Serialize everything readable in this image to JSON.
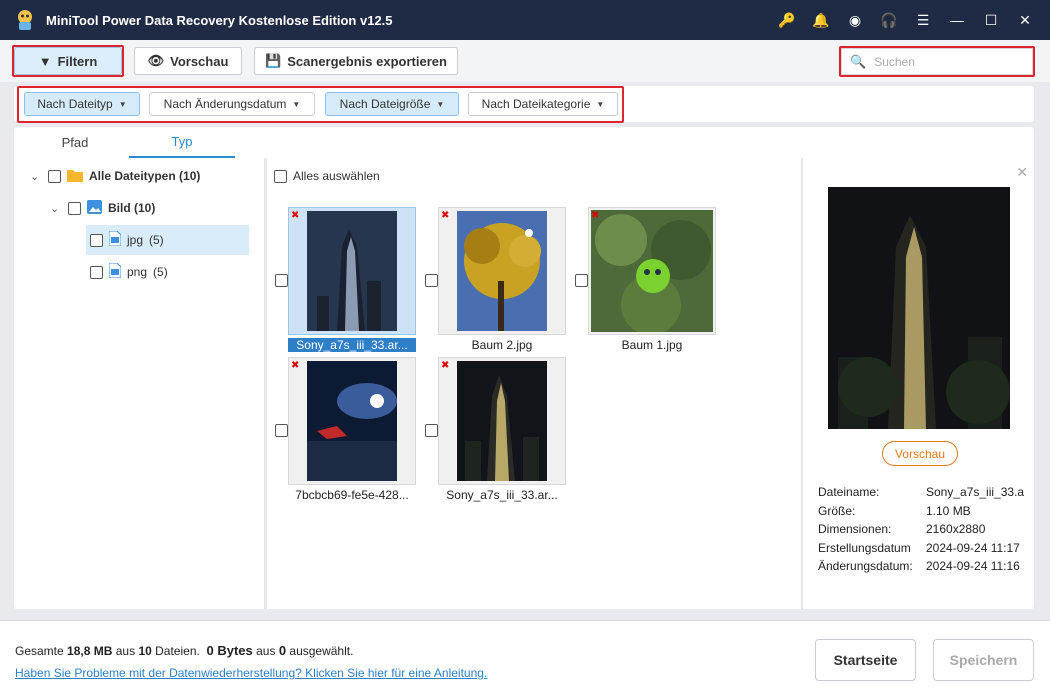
{
  "window": {
    "title": "MiniTool Power Data Recovery Kostenlose Edition v12.5",
    "icons": [
      "key-icon",
      "bell-icon",
      "disc-icon",
      "headset-icon",
      "menu-icon",
      "minimize-icon",
      "maximize-icon",
      "close-icon"
    ]
  },
  "toolbar": {
    "filter_label": "Filtern",
    "preview_label": "Vorschau",
    "export_label": "Scanergebnis exportieren",
    "search_placeholder": "Suchen"
  },
  "filters": [
    {
      "label": "Nach Dateityp",
      "active": true
    },
    {
      "label": "Nach Änderungsdatum",
      "active": false
    },
    {
      "label": "Nach Dateigröße",
      "active": true
    },
    {
      "label": "Nach Dateikategorie",
      "active": false
    }
  ],
  "tabs": [
    {
      "label": "Pfad",
      "selected": false
    },
    {
      "label": "Typ",
      "selected": true
    }
  ],
  "tree": [
    {
      "label": "Alle Dateitypen (10)",
      "bold": true,
      "icon": "folder-icon"
    },
    {
      "label": "Bild (10)",
      "bold": true,
      "icon": "image-icon"
    },
    {
      "label": "jpg",
      "count": "(5)",
      "icon": "file-icon",
      "selected": true
    },
    {
      "label": "png",
      "count": "(5)",
      "icon": "file-icon",
      "selected": false
    }
  ],
  "grid": {
    "select_all_label": "Alles auswählen",
    "files": [
      {
        "name": "Sony_a7s_iii_33.ar...",
        "selected": true,
        "image": "tower-night"
      },
      {
        "name": "Baum 2.jpg",
        "selected": false,
        "image": "tree-yellow"
      },
      {
        "name": "Baum 1.jpg",
        "selected": false,
        "image": "tree-green"
      },
      {
        "name": "7bcbcb69-fe5e-428...",
        "selected": false,
        "image": "airplane-window"
      },
      {
        "name": "Sony_a7s_iii_33.ar...",
        "selected": false,
        "image": "tower-night"
      }
    ]
  },
  "preview_panel": {
    "button_label": "Vorschau",
    "meta": [
      {
        "key": "Dateiname:",
        "value": "Sony_a7s_iii_33.a"
      },
      {
        "key": "Größe:",
        "value": "1.10 MB"
      },
      {
        "key": "Dimensionen:",
        "value": "2160x2880"
      },
      {
        "key": "Erstellungsdatum",
        "value": "2024-09-24 11:17"
      },
      {
        "key": "Änderungsdatum:",
        "value": "2024-09-24 11:16"
      }
    ]
  },
  "footer": {
    "summary_prefix": "Gesamte",
    "total_size": "18,8 MB",
    "summary_mid": "aus",
    "total_files": "10",
    "summary_files": "Dateien.",
    "selected_size": "0 Bytes",
    "summary_aus": "aus",
    "selected_count": "0",
    "summary_suffix": "ausgewählt.",
    "help_link": "Haben Sie Probleme mit der Datenwiederherstellung? Klicken Sie hier für eine Anleitung.",
    "home_label": "Startseite",
    "save_label": "Speichern"
  },
  "colors": {
    "titlebar": "#1f2a44",
    "accent": "#2d8ad2",
    "highlight": "#e0242f",
    "orange": "#e07a1b"
  }
}
